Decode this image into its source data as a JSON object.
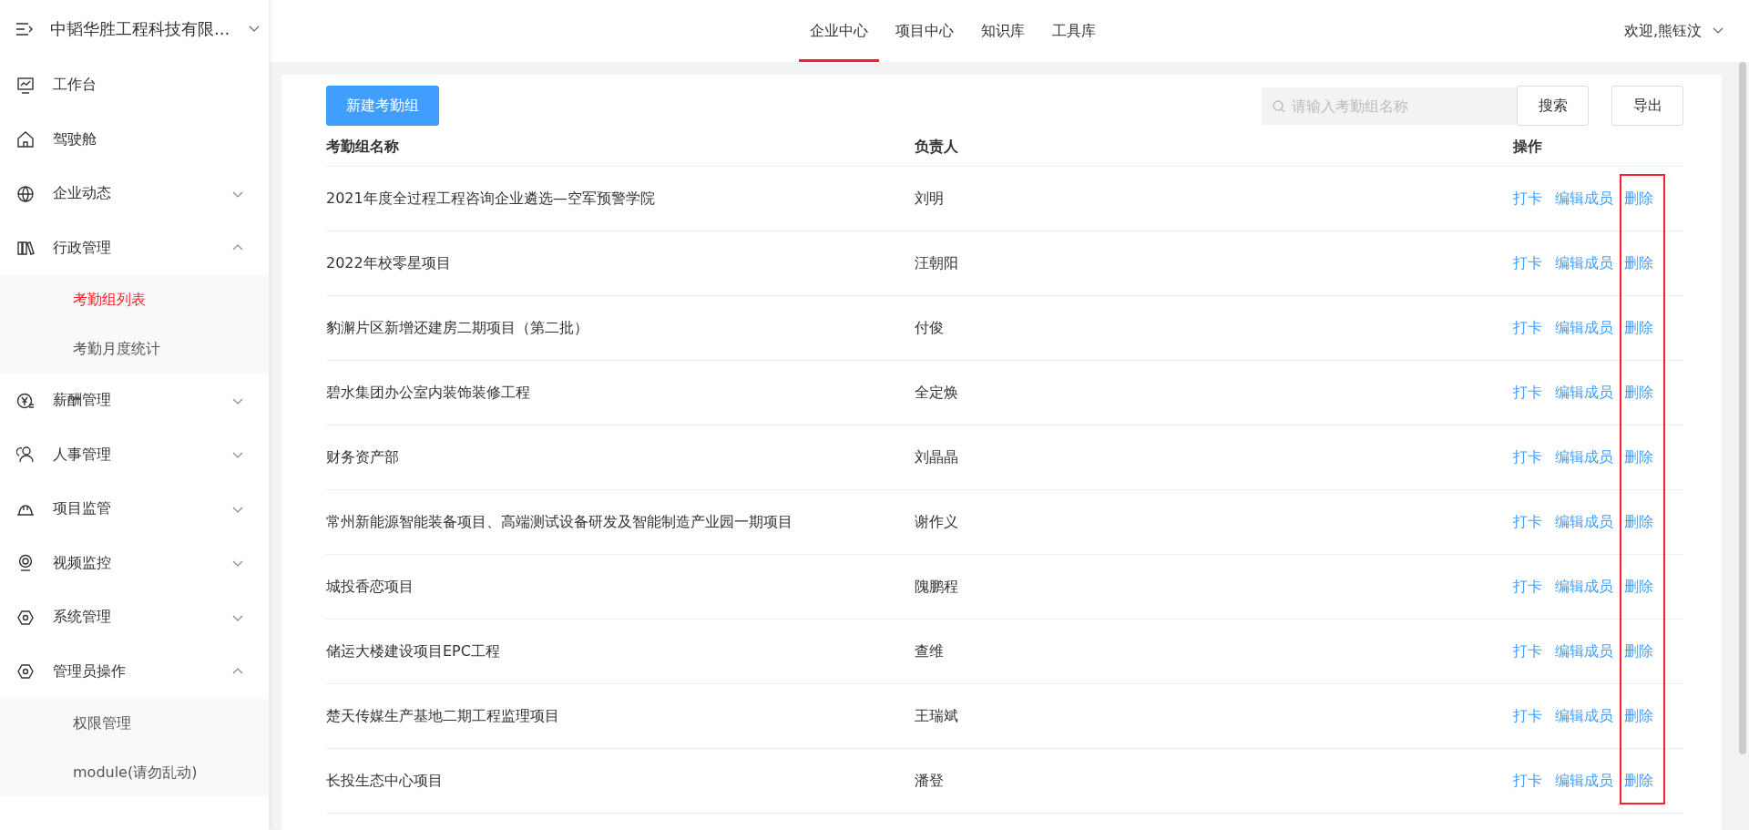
{
  "sidebar": {
    "company": "中韬华胜工程科技有限...",
    "items": [
      {
        "label": "工作台"
      },
      {
        "label": "驾驶舱"
      },
      {
        "label": "企业动态",
        "expanded": false
      },
      {
        "label": "行政管理",
        "expanded": true,
        "children": [
          {
            "label": "考勤组列表",
            "selected": true
          },
          {
            "label": "考勤月度统计",
            "selected": false
          }
        ]
      },
      {
        "label": "薪酬管理",
        "expanded": false
      },
      {
        "label": "人事管理",
        "expanded": false
      },
      {
        "label": "项目监管",
        "expanded": false
      },
      {
        "label": "视频监控",
        "expanded": false
      },
      {
        "label": "系统管理",
        "expanded": false
      },
      {
        "label": "管理员操作",
        "expanded": true,
        "children": [
          {
            "label": "权限管理",
            "selected": false
          },
          {
            "label": "module(请勿乱动)",
            "selected": false
          }
        ]
      }
    ]
  },
  "nav": {
    "tabs": [
      {
        "label": "企业中心",
        "selected": true
      },
      {
        "label": "项目中心",
        "selected": false
      },
      {
        "label": "知识库",
        "selected": false
      },
      {
        "label": "工具库",
        "selected": false
      }
    ],
    "user": "欢迎,熊钰汶"
  },
  "toolbar": {
    "new_button": "新建考勤组",
    "search": {
      "placeholder": "请输入考勤组名称"
    },
    "search_button": "搜索",
    "export_button": "导出"
  },
  "table": {
    "columns": [
      "考勤组名称",
      "负责人",
      "操作"
    ],
    "rows": [
      {
        "name": "2021年度全过程工程咨询企业遴选—空军预警学院",
        "owner": "刘明",
        "actions": [
          "打卡",
          "编辑成员",
          "删除"
        ]
      },
      {
        "name": "2022年校零星项目",
        "owner": "汪朝阳",
        "actions": [
          "打卡",
          "编辑成员",
          "删除"
        ]
      },
      {
        "name": "豹澥片区新增还建房二期项目（第二批）",
        "owner": "付俊",
        "actions": [
          "打卡",
          "编辑成员",
          "删除"
        ]
      },
      {
        "name": "碧水集团办公室内装饰装修工程",
        "owner": "全定焕",
        "actions": [
          "打卡",
          "编辑成员",
          "删除"
        ]
      },
      {
        "name": "财务资产部",
        "owner": "刘晶晶",
        "actions": [
          "打卡",
          "编辑成员",
          "删除"
        ]
      },
      {
        "name": "常州新能源智能装备项目、高端测试设备研发及智能制造产业园一期项目",
        "owner": "谢作义",
        "actions": [
          "打卡",
          "编辑成员",
          "删除"
        ]
      },
      {
        "name": "城投香恋项目",
        "owner": "隗鹏程",
        "actions": [
          "打卡",
          "编辑成员",
          "删除"
        ]
      },
      {
        "name": "储运大楼建设项目EPC工程",
        "owner": "查维",
        "actions": [
          "打卡",
          "编辑成员",
          "删除"
        ]
      },
      {
        "name": "楚天传媒生产基地二期工程监理项目",
        "owner": "王瑞斌",
        "actions": [
          "打卡",
          "编辑成员",
          "删除"
        ]
      },
      {
        "name": "长投生态中心项目",
        "owner": "潘登",
        "actions": [
          "打卡",
          "编辑成员",
          "删除"
        ]
      }
    ]
  }
}
